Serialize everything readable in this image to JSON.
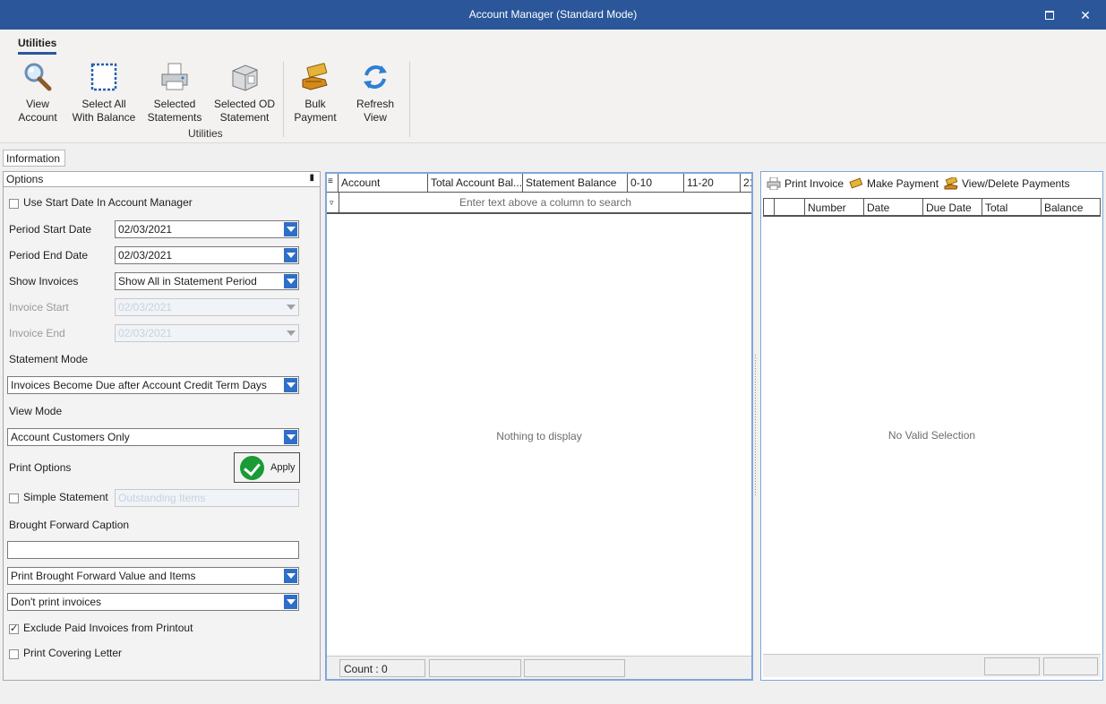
{
  "window": {
    "title": "Account Manager (Standard Mode)",
    "maximize_icon": "maximize-icon",
    "close_glyph": "✕"
  },
  "ribbon": {
    "tab": "Utilities",
    "group_label": "Utilities",
    "buttons": [
      {
        "line1": "View",
        "line2": "Account",
        "icon": "magnifier-icon"
      },
      {
        "line1": "Select All",
        "line2": "With Balance",
        "icon": "dashed-box-icon"
      },
      {
        "line1": "Selected",
        "line2": "Statements",
        "icon": "printer-icon"
      },
      {
        "line1": "Selected OD",
        "line2": "Statement",
        "icon": "box-printer-icon"
      },
      {
        "line1": "Bulk",
        "line2": "Payment",
        "icon": "money-hand-icon"
      },
      {
        "line1": "Refresh",
        "line2": "View",
        "icon": "refresh-icon"
      }
    ]
  },
  "info_tab": "Information",
  "options": {
    "header": "Options",
    "use_start_date": {
      "label": "Use Start Date In Account Manager",
      "checked": false
    },
    "period_start": {
      "label": "Period Start Date",
      "value": "02/03/2021"
    },
    "period_end": {
      "label": "Period End Date",
      "value": "02/03/2021"
    },
    "show_invoices": {
      "label": "Show Invoices",
      "value": "Show All in Statement Period"
    },
    "invoice_start": {
      "label": "Invoice Start",
      "value": "02/03/2021"
    },
    "invoice_end": {
      "label": "Invoice End",
      "value": "02/03/2021"
    },
    "statement_mode": {
      "label": "Statement Mode",
      "value": "Invoices Become Due after Account Credit Term Days"
    },
    "view_mode": {
      "label": "View Mode",
      "value": "Account Customers Only"
    },
    "print_options": {
      "label": "Print Options"
    },
    "apply_label": "Apply",
    "simple_statement": {
      "label": "Simple Statement",
      "checked": false,
      "field_value": "Outstanding Items"
    },
    "brought_forward": {
      "label": "Brought Forward Caption",
      "value": ""
    },
    "brought_forward_mode": "Print Brought Forward Value and Items",
    "print_invoices_mode": "Don't print invoices",
    "exclude_paid": {
      "label": "Exclude Paid Invoices from Printout",
      "checked": true
    },
    "covering_letter": {
      "label": "Print Covering Letter",
      "checked": false
    }
  },
  "grid": {
    "columns": [
      "Account",
      "Total Account Bal...",
      "Statement Balance",
      "0-10",
      "11-20",
      "21"
    ],
    "search_hint": "Enter text above a column to search",
    "empty_text": "Nothing to display",
    "footer_count": "Count : 0"
  },
  "invoices": {
    "toolbar": {
      "print_invoice": "Print Invoice",
      "make_payment": "Make Payment",
      "view_delete_payments": "View/Delete Payments"
    },
    "columns": [
      "",
      "",
      "Number",
      "Date",
      "Due Date",
      "Total",
      "Balance"
    ],
    "empty_text": "No Valid Selection"
  }
}
